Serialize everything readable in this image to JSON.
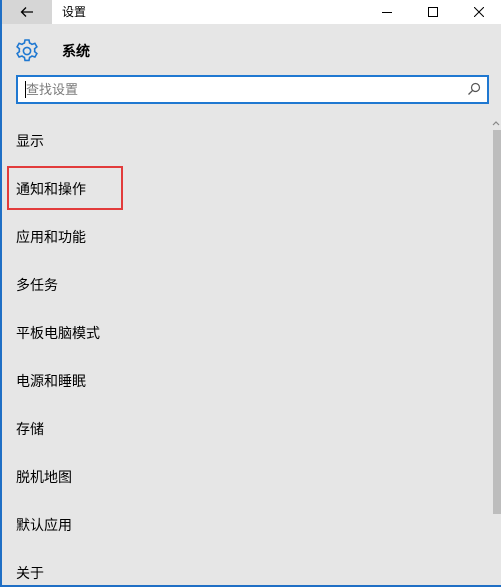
{
  "window": {
    "title": "设置"
  },
  "header": {
    "title": "系统",
    "icon": "gear-icon"
  },
  "search": {
    "placeholder": "查找设置",
    "value": ""
  },
  "nav": {
    "items": [
      {
        "label": "显示"
      },
      {
        "label": "通知和操作",
        "highlighted": true
      },
      {
        "label": "应用和功能"
      },
      {
        "label": "多任务"
      },
      {
        "label": "平板电脑模式"
      },
      {
        "label": "电源和睡眠"
      },
      {
        "label": "存储"
      },
      {
        "label": "脱机地图"
      },
      {
        "label": "默认应用"
      },
      {
        "label": "关于"
      }
    ]
  },
  "colors": {
    "accent": "#1f78d1",
    "highlight": "#e23b3b",
    "background": "#e6e6e6"
  }
}
